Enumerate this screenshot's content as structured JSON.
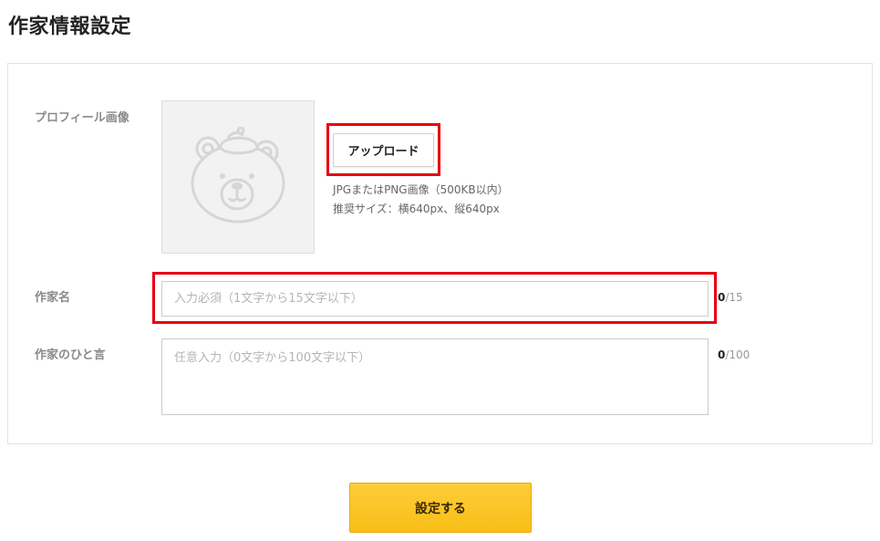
{
  "page": {
    "title": "作家情報設定"
  },
  "profile_image": {
    "label": "プロフィール画像",
    "upload_label": "アップロード",
    "hint_format": "JPGまたはPNG画像（500KB以内）",
    "hint_size": "推奨サイズ：横640px、縦640px",
    "avatar_icon": "bear-avatar-placeholder-icon"
  },
  "author_name": {
    "label": "作家名",
    "value": "",
    "placeholder": "入力必須（1文字から15文字以下）",
    "count_current": "0",
    "count_max": "/15"
  },
  "author_bio": {
    "label": "作家のひと言",
    "value": "",
    "placeholder": "任意入力（0文字から100文字以下）",
    "count_current": "0",
    "count_max": "/100"
  },
  "submit": {
    "label": "設定する"
  },
  "colors": {
    "highlight": "#e60012",
    "submit_button": "#fbc52a",
    "label_text": "#8a8a8a"
  }
}
